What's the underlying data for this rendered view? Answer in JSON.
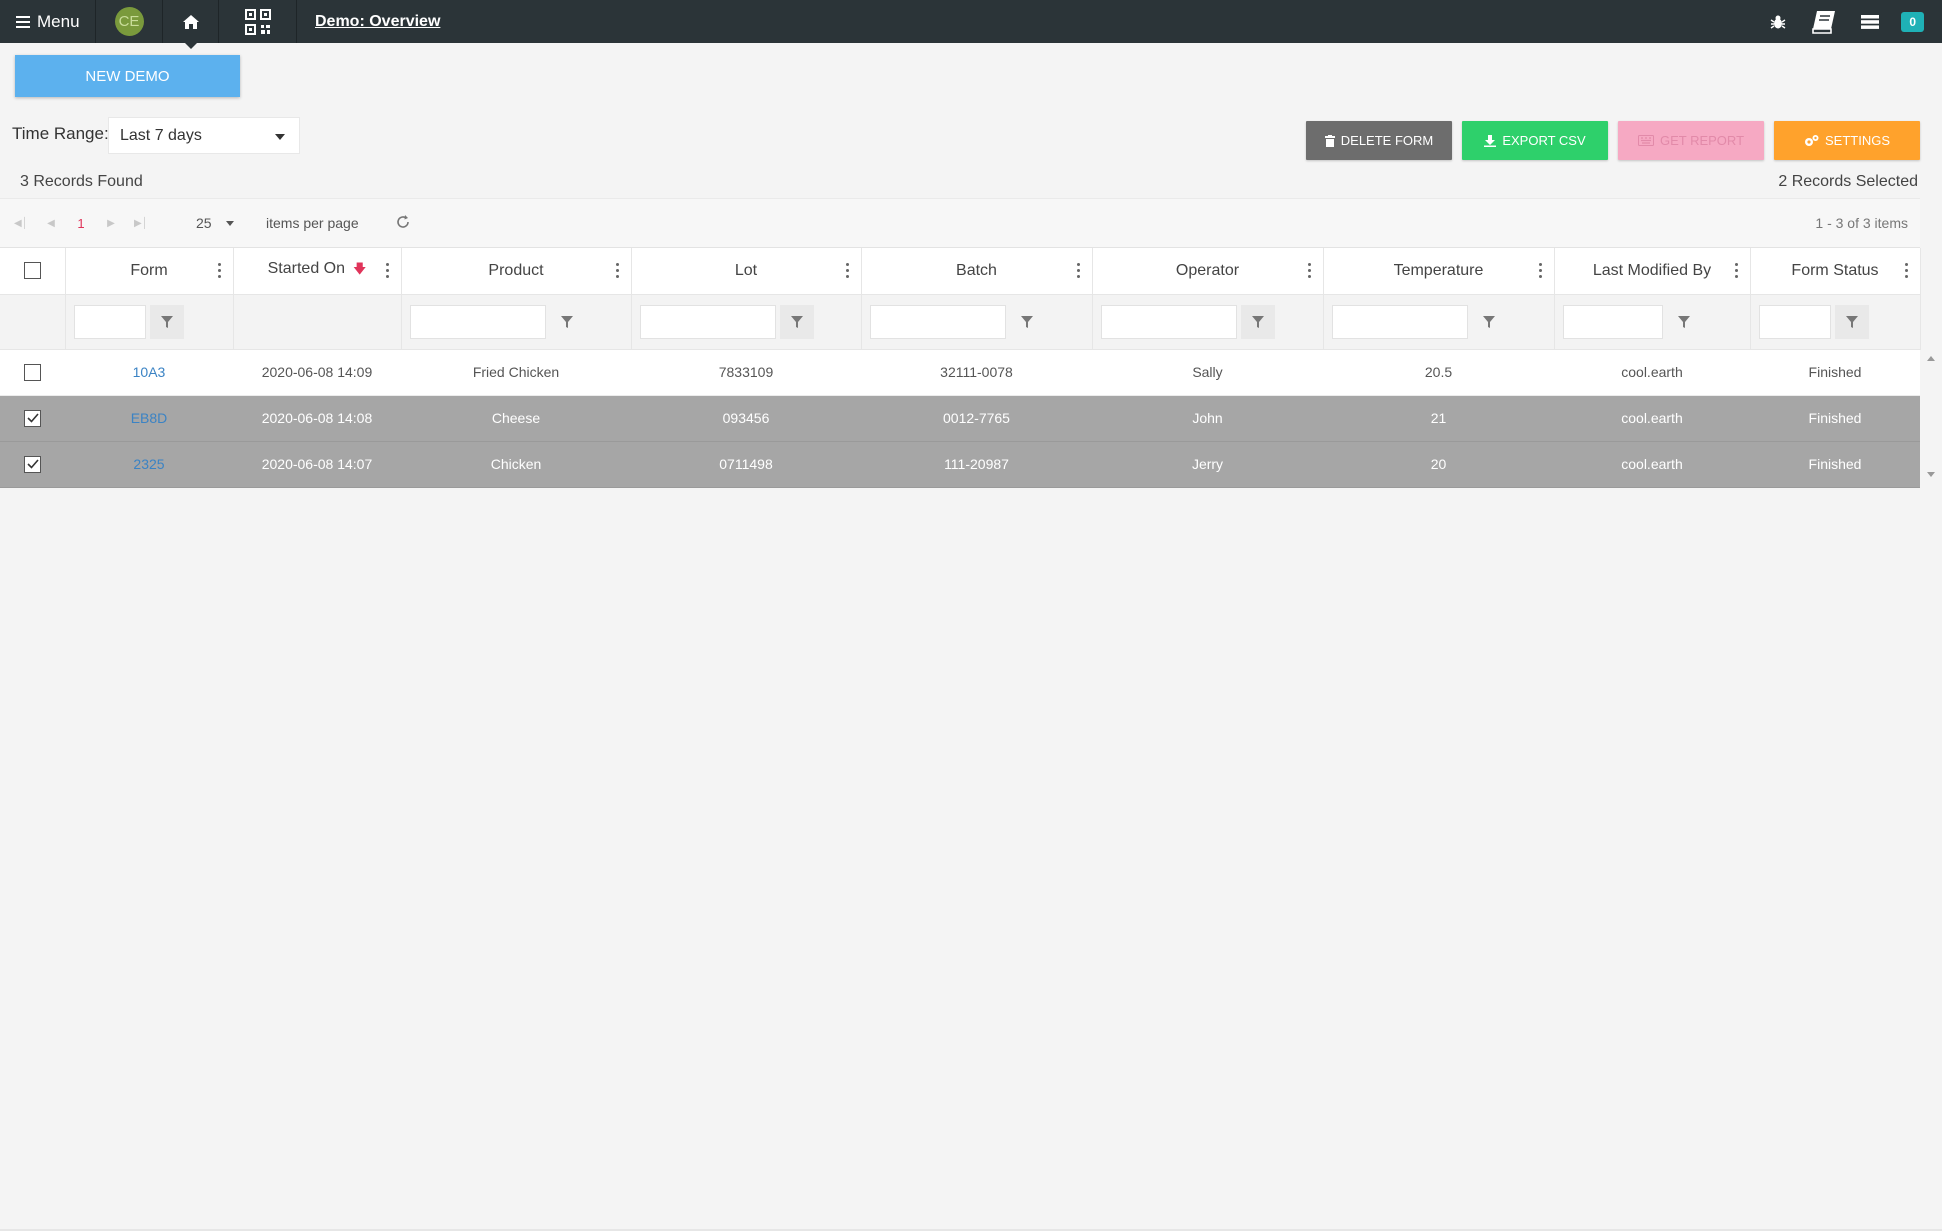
{
  "topbar": {
    "menu_label": "Menu",
    "avatar_initials": "CE",
    "page_title": "Demo: Overview",
    "notification_count": "0"
  },
  "toolbar": {
    "new_demo_label": "NEW DEMO",
    "time_range_label": "Time Range:",
    "time_range_value": "Last 7 days",
    "delete_label": "DELETE FORM",
    "export_label": "EXPORT CSV",
    "report_label": "GET REPORT",
    "settings_label": "SETTINGS"
  },
  "summary": {
    "records_found": "3 Records Found",
    "records_selected": "2 Records Selected"
  },
  "pager": {
    "current_page": "1",
    "page_size": "25",
    "page_size_label": "items per page",
    "info": "1 - 3 of 3 items"
  },
  "table": {
    "columns": [
      "Form",
      "Started On",
      "Product",
      "Lot",
      "Batch",
      "Operator",
      "Temperature",
      "Last Modified By",
      "Form Status"
    ],
    "rows": [
      {
        "selected": false,
        "form": "10A3",
        "started_on": "2020-06-08 14:09",
        "product": "Fried Chicken",
        "lot": "7833109",
        "batch": "32111-0078",
        "operator": "Sally",
        "temperature": "20.5",
        "modified_by": "cool.earth",
        "status": "Finished"
      },
      {
        "selected": true,
        "form": "EB8D",
        "started_on": "2020-06-08 14:08",
        "product": "Cheese",
        "lot": "093456",
        "batch": "0012-7765",
        "operator": "John",
        "temperature": "21",
        "modified_by": "cool.earth",
        "status": "Finished"
      },
      {
        "selected": true,
        "form": "2325",
        "started_on": "2020-06-08 14:07",
        "product": "Chicken",
        "lot": "0711498",
        "batch": "111-20987",
        "operator": "Jerry",
        "temperature": "20",
        "modified_by": "cool.earth",
        "status": "Finished"
      }
    ]
  },
  "colors": {
    "topbar": "#2b3438",
    "new_demo": "#5cb1ee",
    "delete": "#6d6d6d",
    "export": "#2ed06b",
    "report": "#f6a9c3",
    "settings": "#ffa22c",
    "selected_row": "#a6a6a6",
    "link": "#3b83c4"
  }
}
